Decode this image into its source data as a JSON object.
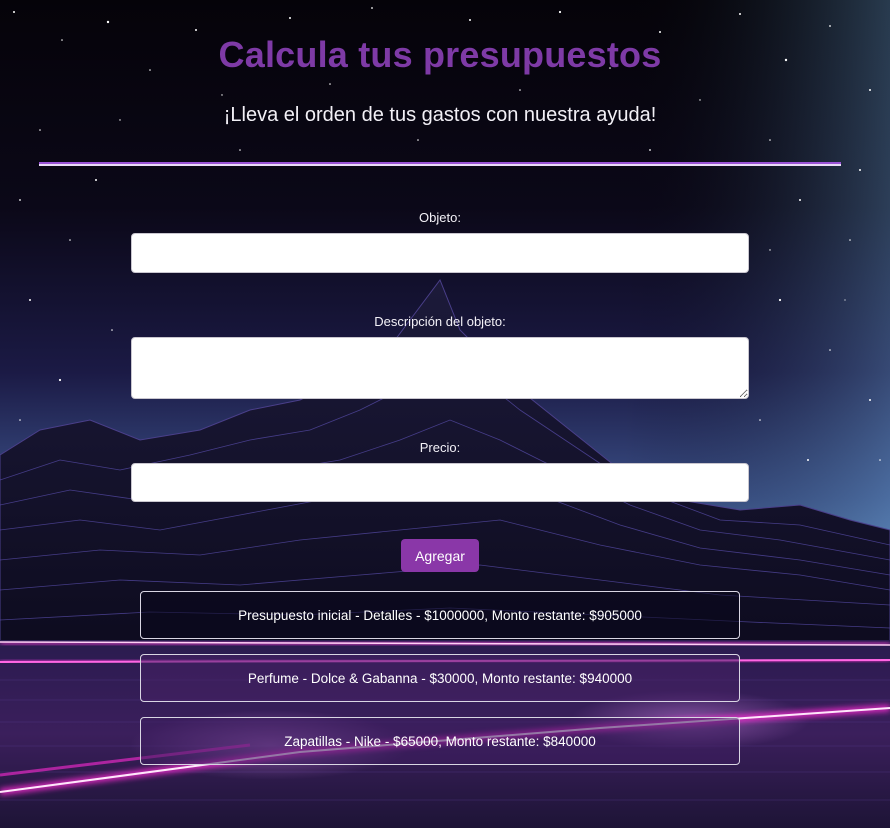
{
  "header": {
    "title": "Calcula tus presupuestos",
    "subtitle": "¡Lleva el orden de tus gastos con nuestra ayuda!"
  },
  "form": {
    "object": {
      "label": "Objeto:",
      "value": "",
      "placeholder": ""
    },
    "description": {
      "label": "Descripción del objeto:",
      "value": "",
      "placeholder": ""
    },
    "price": {
      "label": "Precio:",
      "value": "",
      "placeholder": ""
    },
    "submit_label": "Agregar"
  },
  "budget_items": [
    {
      "text": "Presupuesto inicial - Detalles - $1000000, Monto restante: $905000"
    },
    {
      "text": "Perfume - Dolce & Gabanna - $30000, Monto restante: $940000"
    },
    {
      "text": "Zapatillas - Nike - $65000, Monto restante: $840000"
    }
  ],
  "colors": {
    "title": "#7e3aa6",
    "button": "#8a37a8",
    "divider": "#9a52d6",
    "neon_line": "#ff2bd6"
  },
  "background": {
    "scene": "synthwave-mountain-night-sky"
  }
}
